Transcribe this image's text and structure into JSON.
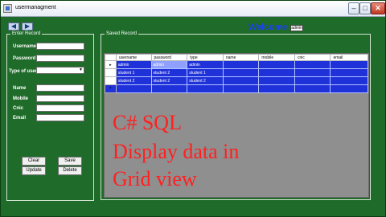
{
  "window": {
    "title": "usermanagment",
    "min_glyph": "–",
    "max_glyph": "□",
    "close_glyph": "✕"
  },
  "toolbar": {
    "left_glyph": "◀",
    "right_glyph": "▶"
  },
  "welcome": {
    "text": "Welcome",
    "user": "admin"
  },
  "enter_record": {
    "title": "Enter Record",
    "username_label": "Username",
    "password_label": "Password",
    "type_label": "Type of user",
    "name_label": "Name",
    "mobile_label": "Mobile",
    "cnic_label": "Cnic",
    "email_label": "Email",
    "username_value": "",
    "password_value": "",
    "type_value": "",
    "name_value": "",
    "mobile_value": "",
    "cnic_value": "",
    "email_value": ""
  },
  "buttons": {
    "clear": "Clear",
    "save": "Save",
    "update": "Update",
    "delete": "Delete"
  },
  "saved_record": {
    "title": "Saved Record",
    "columns": [
      "username",
      "password",
      "type",
      "name",
      "mobile",
      "cnic",
      "email"
    ],
    "rows": [
      [
        "admin",
        "admin",
        "admin",
        "",
        "",
        "",
        ""
      ],
      [
        "student 1",
        "student 2",
        "student 1",
        "",
        "",
        "",
        ""
      ],
      [
        "student 2",
        "student 2",
        "student 2",
        "",
        "",
        "",
        ""
      ]
    ],
    "current_row_marker": "▸",
    "new_row_marker": "*"
  },
  "overlay": {
    "line1": "C# SQL",
    "line2": "Display data in",
    "line3": "Grid view"
  }
}
